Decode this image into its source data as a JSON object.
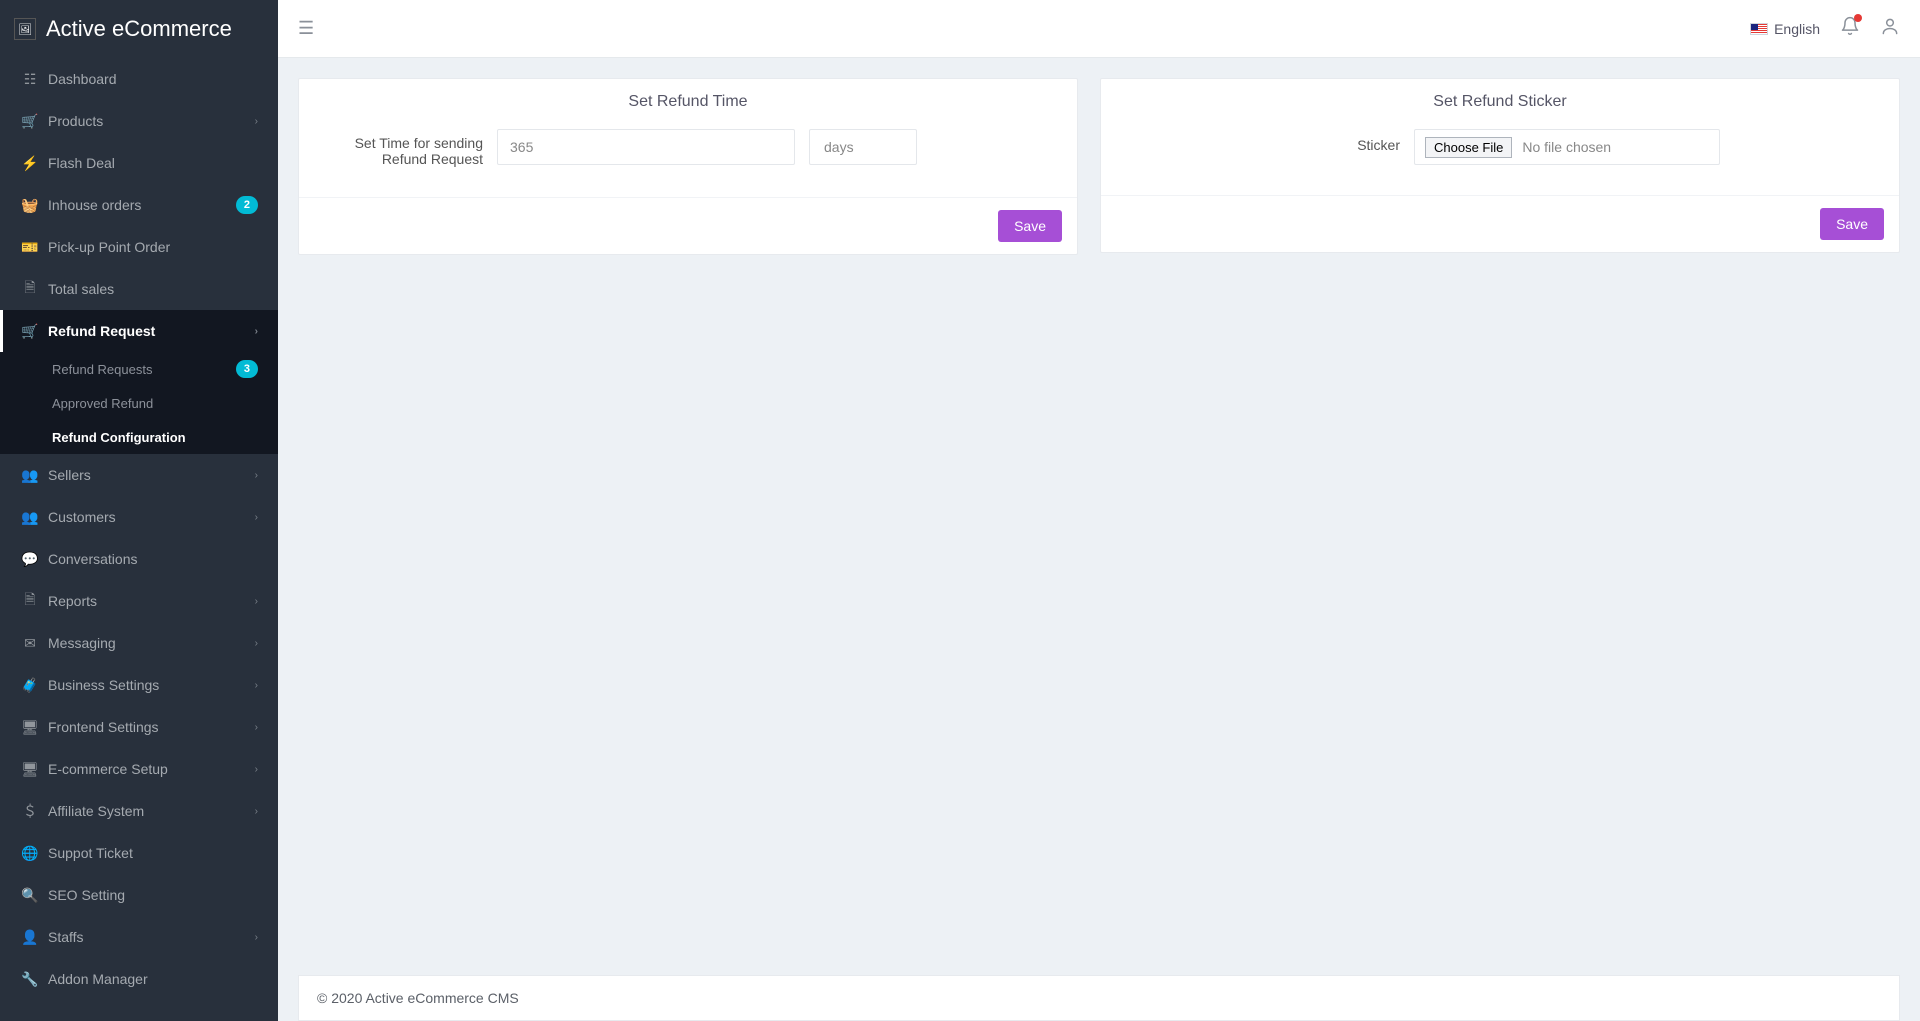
{
  "brand": {
    "title": "Active eCommerce"
  },
  "topbar": {
    "language": "English"
  },
  "sidebar": {
    "items": [
      {
        "icon": "dashboard",
        "label": "Dashboard"
      },
      {
        "icon": "cart",
        "label": "Products",
        "expandable": true
      },
      {
        "icon": "bolt",
        "label": "Flash Deal"
      },
      {
        "icon": "basket",
        "label": "Inhouse orders",
        "badge": "2"
      },
      {
        "icon": "ticket",
        "label": "Pick-up Point Order"
      },
      {
        "icon": "file",
        "label": "Total sales"
      },
      {
        "icon": "cart",
        "label": "Refund Request",
        "expandable": true,
        "active": true
      },
      {
        "icon": "users-plus",
        "label": "Sellers",
        "expandable": true
      },
      {
        "icon": "users-plus",
        "label": "Customers",
        "expandable": true
      },
      {
        "icon": "chat",
        "label": "Conversations"
      },
      {
        "icon": "doc",
        "label": "Reports",
        "expandable": true
      },
      {
        "icon": "mail",
        "label": "Messaging",
        "expandable": true
      },
      {
        "icon": "briefcase",
        "label": "Business Settings",
        "expandable": true
      },
      {
        "icon": "monitor",
        "label": "Frontend Settings",
        "expandable": true
      },
      {
        "icon": "monitor",
        "label": "E-commerce Setup",
        "expandable": true
      },
      {
        "icon": "dollar",
        "label": "Affiliate System",
        "expandable": true
      },
      {
        "icon": "globe",
        "label": "Suppot Ticket"
      },
      {
        "icon": "search",
        "label": "SEO Setting"
      },
      {
        "icon": "user",
        "label": "Staffs",
        "expandable": true
      },
      {
        "icon": "wrench",
        "label": "Addon Manager"
      }
    ],
    "refund_subitems": [
      {
        "label": "Refund Requests",
        "badge": "3"
      },
      {
        "label": "Approved Refund"
      },
      {
        "label": "Refund Configuration",
        "active": true
      }
    ]
  },
  "panel_time": {
    "heading": "Set Refund Time",
    "field_label": "Set Time for sending Refund Request",
    "value": "365",
    "unit": "days",
    "save_label": "Save"
  },
  "panel_sticker": {
    "heading": "Set Refund Sticker",
    "field_label": "Sticker",
    "choose_file": "Choose File",
    "no_file": "No file chosen",
    "save_label": "Save"
  },
  "footer": {
    "copyright": "© 2020 Active eCommerce CMS"
  },
  "icons": {
    "dashboard": "☷",
    "cart": "🛒",
    "bolt": "⚡",
    "basket": "🧺",
    "ticket": "🎫",
    "file": "🗎",
    "users-plus": "👥",
    "chat": "💬",
    "doc": "🗎",
    "mail": "✉",
    "briefcase": "🧳",
    "monitor": "🖥",
    "dollar": "＄",
    "globe": "🌐",
    "search": "🔍",
    "user": "👤",
    "wrench": "🔧"
  }
}
